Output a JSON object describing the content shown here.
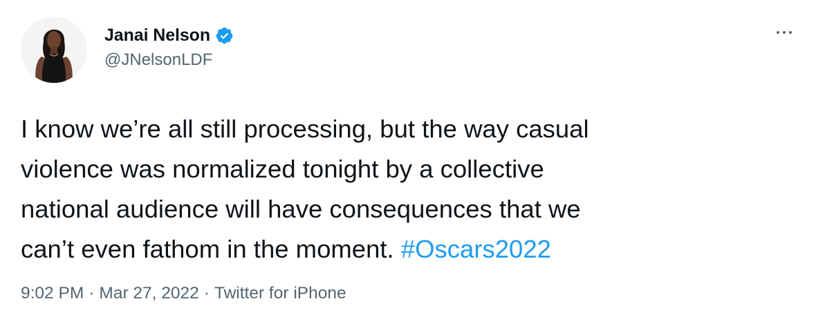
{
  "author": {
    "display_name": "Janai Nelson",
    "handle": "@JNelsonLDF",
    "verified": true
  },
  "tweet": {
    "lines": [
      "I know we’re all still processing, but the way casual",
      "violence was normalized tonight by a collective",
      "national audience will have consequences that we",
      "can’t even fathom in the moment. "
    ],
    "hashtag": "#Oscars2022"
  },
  "meta": {
    "time": "9:02 PM",
    "separator": "·",
    "date": "Mar 27, 2022",
    "source": "Twitter for iPhone"
  },
  "icons": {
    "more": "more-horizontal-icon",
    "verified": "verified-badge-icon"
  },
  "colors": {
    "text": "#0f1419",
    "secondary": "#536471",
    "link": "#1d9bf0",
    "verified": "#1d9bf0",
    "background": "#ffffff"
  }
}
